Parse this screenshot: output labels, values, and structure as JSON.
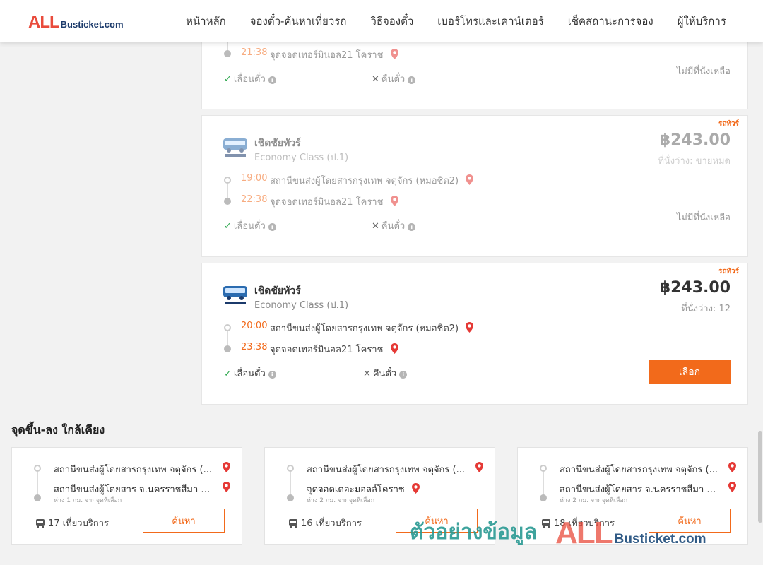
{
  "header": {
    "logo_all": "ALL",
    "logo_rest": "Busticket.com",
    "nav": [
      "หน้าหลัก",
      "จองตั๋ว-ค้นหาเที่ยวรถ",
      "วิธีจองตั๋ว",
      "เบอร์โทรและเคาน์เตอร์",
      "เช็คสถานะการจอง",
      "ผู้ให้บริการ"
    ]
  },
  "trips": [
    {
      "arrive_time": "21:38",
      "arrive_stop": "จุดจอดเทอร์มินอล21 โคราช",
      "option_change": "เลื่อนตั๋ว",
      "option_refund": "คืนตั๋ว",
      "status": "ไม่มีที่นั่งเหลือ"
    },
    {
      "tag": "รถทัวร์",
      "operator": "เชิดชัยทัวร์",
      "class": "Economy Class (ป.1)",
      "price": "฿243.00",
      "seats": "ที่นั่งว่าง: ขายหมด",
      "depart_time": "19:00",
      "depart_stop": "สถานีขนส่งผู้โดยสารกรุงเทพ จตุจักร (หมอชิต2)",
      "arrive_time": "22:38",
      "arrive_stop": "จุดจอดเทอร์มินอล21 โคราช",
      "option_change": "เลื่อนตั๋ว",
      "option_refund": "คืนตั๋ว",
      "status": "ไม่มีที่นั่งเหลือ"
    },
    {
      "tag": "รถทัวร์",
      "operator": "เชิดชัยทัวร์",
      "class": "Economy Class (ป.1)",
      "price": "฿243.00",
      "seats": "ที่นั่งว่าง: 12",
      "depart_time": "20:00",
      "depart_stop": "สถานีขนส่งผู้โดยสารกรุงเทพ จตุจักร (หมอชิต2)",
      "arrive_time": "23:38",
      "arrive_stop": "จุดจอดเทอร์มินอล21 โคราช",
      "option_change": "เลื่อนตั๋ว",
      "option_refund": "คืนตั๋ว",
      "button": "เลือก"
    }
  ],
  "nearby": {
    "title": "จุดขึ้น-ลง ใกล้เคียง",
    "cards": [
      {
        "from": "สถานีขนส่งผู้โดยสารกรุงเทพ จตุจักร (...",
        "to": "สถานีขนส่งผู้โดยสาร จ.นครราชสีมา แ...",
        "distance": "ห่าง 1 กม. จากจุดที่เลือก",
        "trips": "17 เที่ยวบริการ",
        "button": "ค้นหา"
      },
      {
        "from": "สถานีขนส่งผู้โดยสารกรุงเทพ จตุจักร (...",
        "to": "จุดจอดเดอะมอลล์โคราช",
        "distance": "ห่าง 2 กม. จากจุดที่เลือก",
        "trips": "16 เที่ยวบริการ",
        "button": "ค้นหา"
      },
      {
        "from": "สถานีขนส่งผู้โดยสารกรุงเทพ จตุจักร (...",
        "to": "สถานีขนส่งผู้โดยสาร จ.นครราชสีมา แ...",
        "distance": "ห่าง 2 กม. จากจุดที่เลือก",
        "trips": "18 เที่ยวบริการ",
        "button": "ค้นหา"
      }
    ]
  },
  "watermark": {
    "thai": "ตัวอย่างข้อมูล",
    "all": "ALL",
    "rest": "Busticket.com"
  },
  "colors": {
    "accent": "#f26a1b",
    "logo_red": "#e94b3c",
    "logo_navy": "#1b3a6b",
    "check_green": "#2fa84f",
    "pin_red": "#e53935",
    "watermark_teal": "#2a9a93"
  }
}
